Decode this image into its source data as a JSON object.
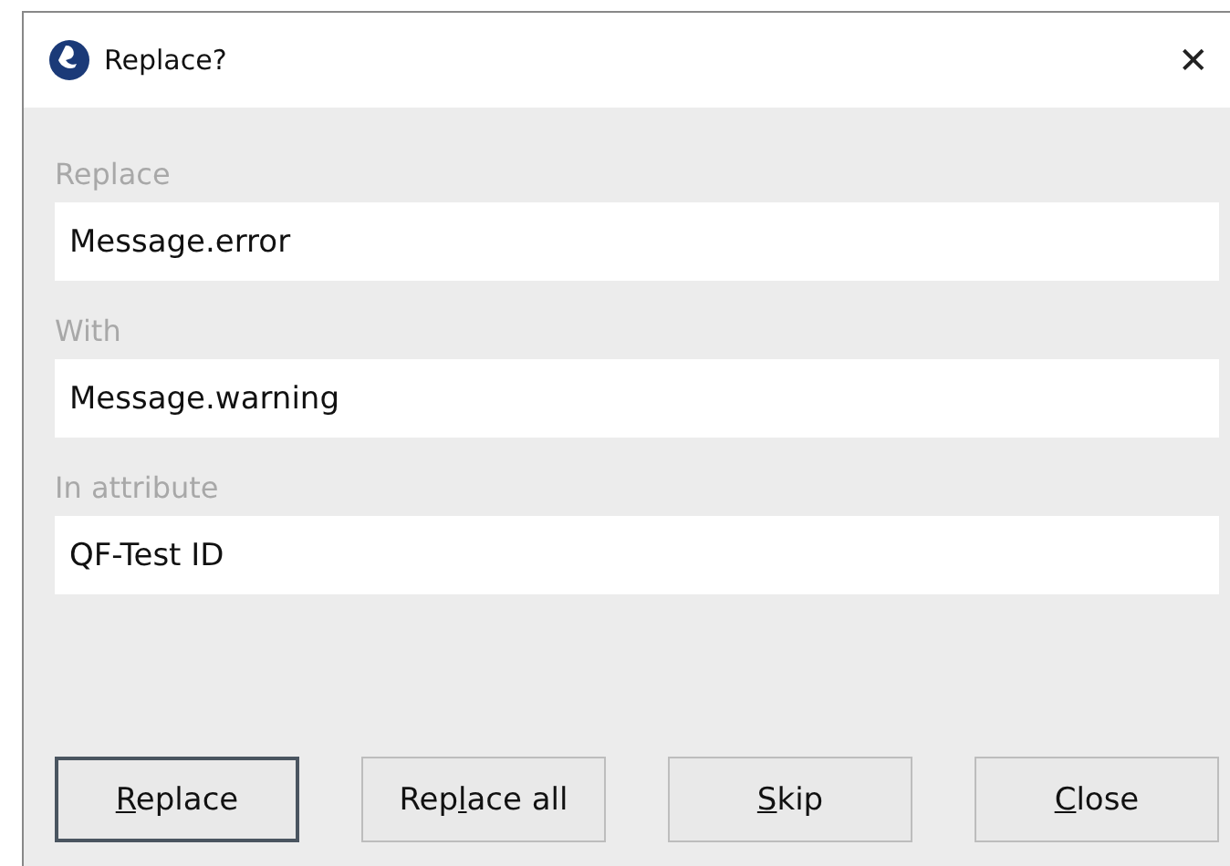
{
  "window": {
    "title": "Replace?",
    "close": "✕"
  },
  "fields": [
    {
      "label": "Replace",
      "value": "Message.error"
    },
    {
      "label": "With",
      "value": "Message.warning"
    },
    {
      "label": "In attribute",
      "value": "QF-Test ID"
    }
  ],
  "buttons": [
    {
      "key": "R",
      "after": "eplace",
      "default": true
    },
    {
      "before": "Rep",
      "key": "l",
      "after": "ace all",
      "default": false
    },
    {
      "key": "S",
      "after": "kip",
      "default": false
    },
    {
      "key": "C",
      "after": "lose",
      "default": false
    }
  ]
}
